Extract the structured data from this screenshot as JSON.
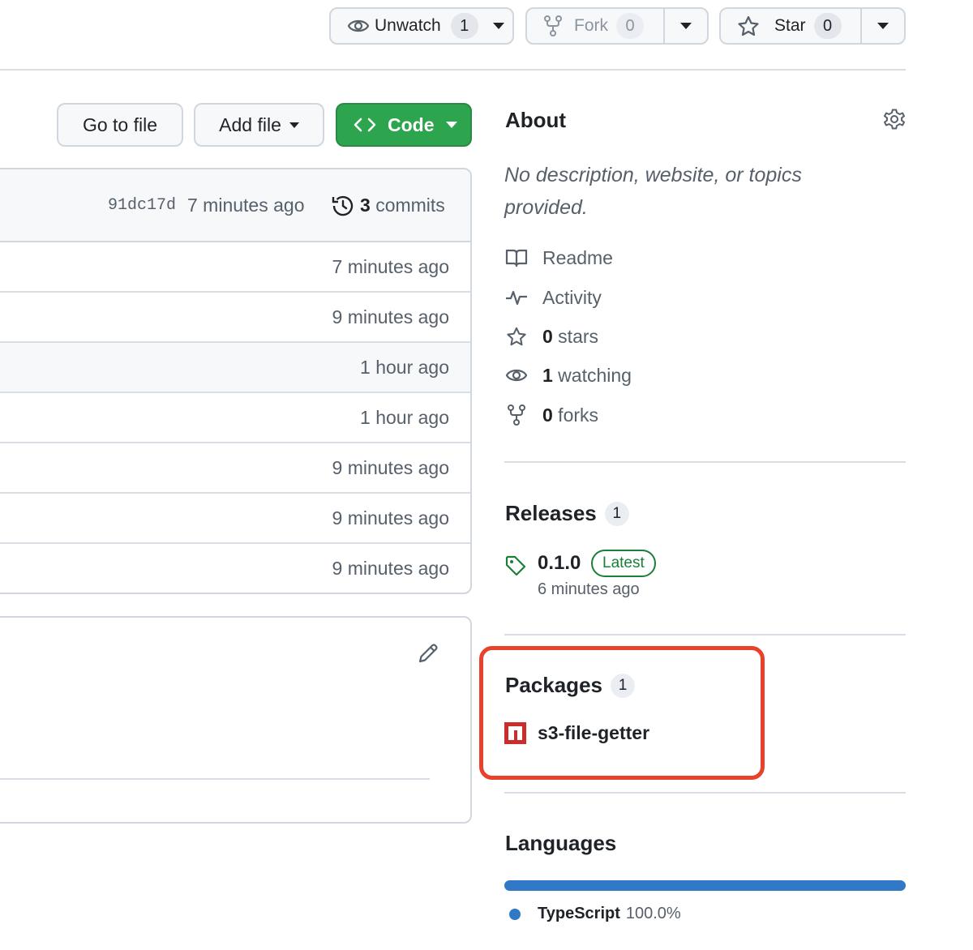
{
  "header": {
    "unwatch": {
      "label": "Unwatch",
      "count": "1"
    },
    "fork": {
      "label": "Fork",
      "count": "0"
    },
    "star": {
      "label": "Star",
      "count": "0"
    }
  },
  "toolbar": {
    "go_to_file": "Go to file",
    "add_file": "Add file",
    "code": "Code"
  },
  "latest_commit": {
    "sha": "91dc17d",
    "time": "7 minutes ago",
    "commits_count": "3",
    "commits_label": "commits"
  },
  "file_rows": [
    {
      "time": "7 minutes ago"
    },
    {
      "time": "9 minutes ago"
    },
    {
      "time": "1 hour ago"
    },
    {
      "time": "1 hour ago"
    },
    {
      "time": "9 minutes ago"
    },
    {
      "time": "9 minutes ago"
    },
    {
      "time": "9 minutes ago"
    }
  ],
  "about": {
    "title": "About",
    "description": "No description, website, or topics provided.",
    "items": [
      {
        "icon": "book-icon",
        "bold": "",
        "label": "Readme"
      },
      {
        "icon": "pulse-icon",
        "bold": "",
        "label": "Activity"
      },
      {
        "icon": "star-icon",
        "bold": "0",
        "label": " stars"
      },
      {
        "icon": "eye-icon",
        "bold": "1",
        "label": " watching"
      },
      {
        "icon": "fork-icon",
        "bold": "0",
        "label": " forks"
      }
    ]
  },
  "releases": {
    "title": "Releases",
    "count": "1",
    "version": "0.1.0",
    "badge": "Latest",
    "time": "6 minutes ago"
  },
  "packages": {
    "title": "Packages",
    "count": "1",
    "item": "s3-file-getter"
  },
  "languages": {
    "title": "Languages",
    "items": [
      {
        "name": "TypeScript",
        "percent": "100.0%",
        "color": "#3178c6"
      }
    ]
  },
  "colors": {
    "accent_green": "#2da44e",
    "highlight_box": "#e8412c",
    "typescript": "#3178c6"
  }
}
